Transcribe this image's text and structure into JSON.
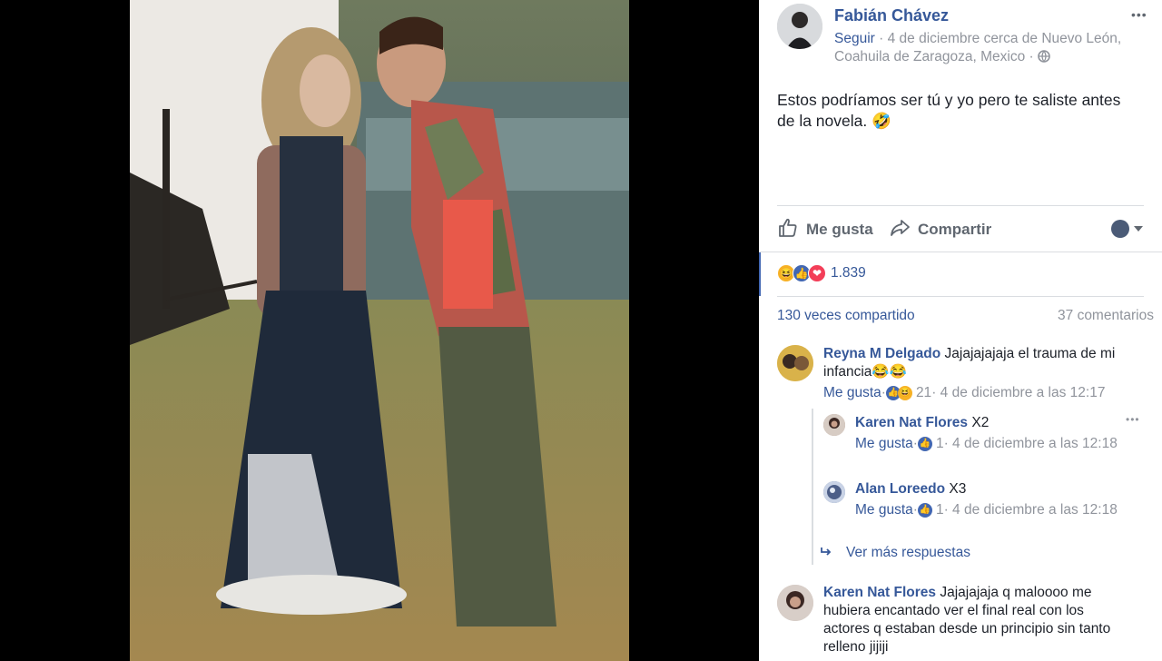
{
  "post": {
    "author": "Fabián Chávez",
    "follow": "Seguir",
    "meta_separator": " · ",
    "date_location": "4 de diciembre cerca de Nuevo León, Coahuila de Zaragoza, Mexico · ",
    "privacy_icon": "globe-icon",
    "text": "Estos podríamos ser tú y yo pero te saliste antes de la novela. 🤣"
  },
  "actions": {
    "like": "Me gusta",
    "share": "Compartir"
  },
  "reactions": {
    "icons": [
      "😆",
      "👍",
      "❤"
    ],
    "count": "1.839"
  },
  "stats": {
    "shares": "130 veces compartido",
    "comments": "37 comentarios"
  },
  "comments": [
    {
      "name": "Reyna M Delgado",
      "text": "Jajajajajaja el trauma de mi infancia😂😂",
      "like": "Me gusta",
      "separator": " · ",
      "reaction_count": "21",
      "time": " · 4 de diciembre a las 12:17"
    },
    {
      "name": "Karen Nat Flores",
      "text": "X2",
      "like": "Me gusta",
      "separator": " · ",
      "reaction_count": "1",
      "time": " · 4 de diciembre a las 12:18"
    },
    {
      "name": "Alan Loreedo",
      "text": "X3",
      "like": "Me gusta",
      "separator": " · ",
      "reaction_count": "1",
      "time": " · 4 de diciembre a las 12:18"
    },
    {
      "name": "Karen Nat Flores",
      "text": "Jajajajaja q maloooo me hubiera encantado ver el final real con los actores q estaban desde un principio sin tanto relleno jijiji"
    }
  ],
  "more_replies": "Ver más respuestas",
  "colors": {
    "link": "#365899",
    "like_blue": "#4267b2",
    "love_red": "#f33e58",
    "haha_yellow": "#f7b125"
  }
}
